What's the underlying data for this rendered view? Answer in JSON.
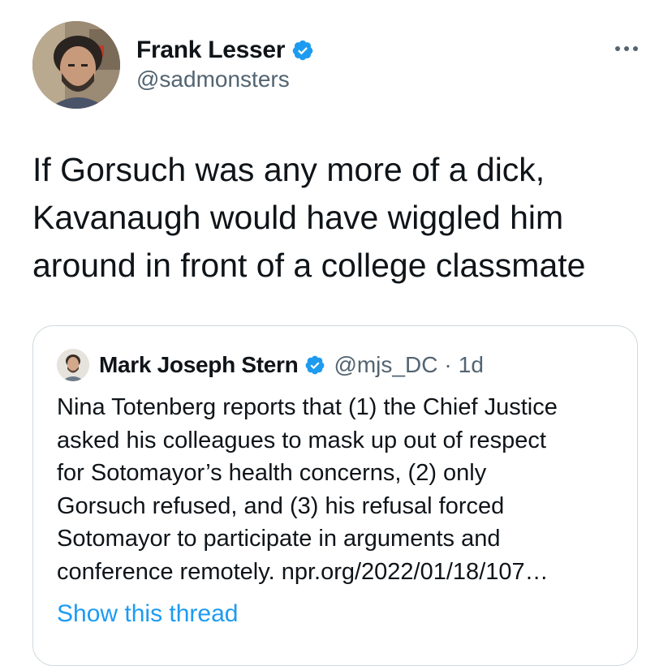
{
  "author": {
    "display_name": "Frank Lesser",
    "handle": "@sadmonsters",
    "verified": true
  },
  "more_icon": "more-horizontal-icon",
  "tweet_text": "If Gorsuch was any more of a dick,\nKavanaugh would have wiggled him\naround in front of a college classmate",
  "quoted_tweet": {
    "display_name": "Mark Joseph Stern",
    "handle": "@mjs_DC",
    "separator": "·",
    "time": "1d",
    "verified": true,
    "text": "Nina Totenberg reports that (1) the Chief Justice\nasked his colleagues to mask up out of respect\nfor Sotomayor’s health concerns, (2) only\nGorsuch refused, and (3) his refusal forced\nSotomayor to participate in arguments and\nconference remotely. npr.org/2022/01/18/107…",
    "show_thread_label": "Show this thread"
  },
  "colors": {
    "text": "#0f1419",
    "secondary": "#536471",
    "accent": "#1d9bf0",
    "border": "#cfd9de"
  }
}
